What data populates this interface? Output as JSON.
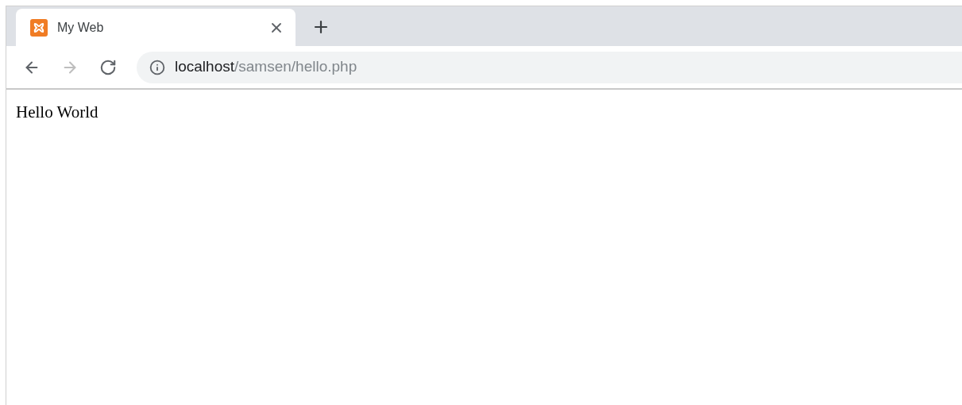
{
  "tabs": [
    {
      "title": "My Web",
      "selected": true
    }
  ],
  "nav_buttons": [
    {
      "kind": "back",
      "disabled": false
    },
    {
      "kind": "forward",
      "disabled": true
    },
    {
      "kind": "reload",
      "disabled": false
    }
  ],
  "address_bar": {
    "host": "localhost",
    "path": "/samsen/hello.php"
  },
  "page": {
    "text": "Hello World"
  }
}
